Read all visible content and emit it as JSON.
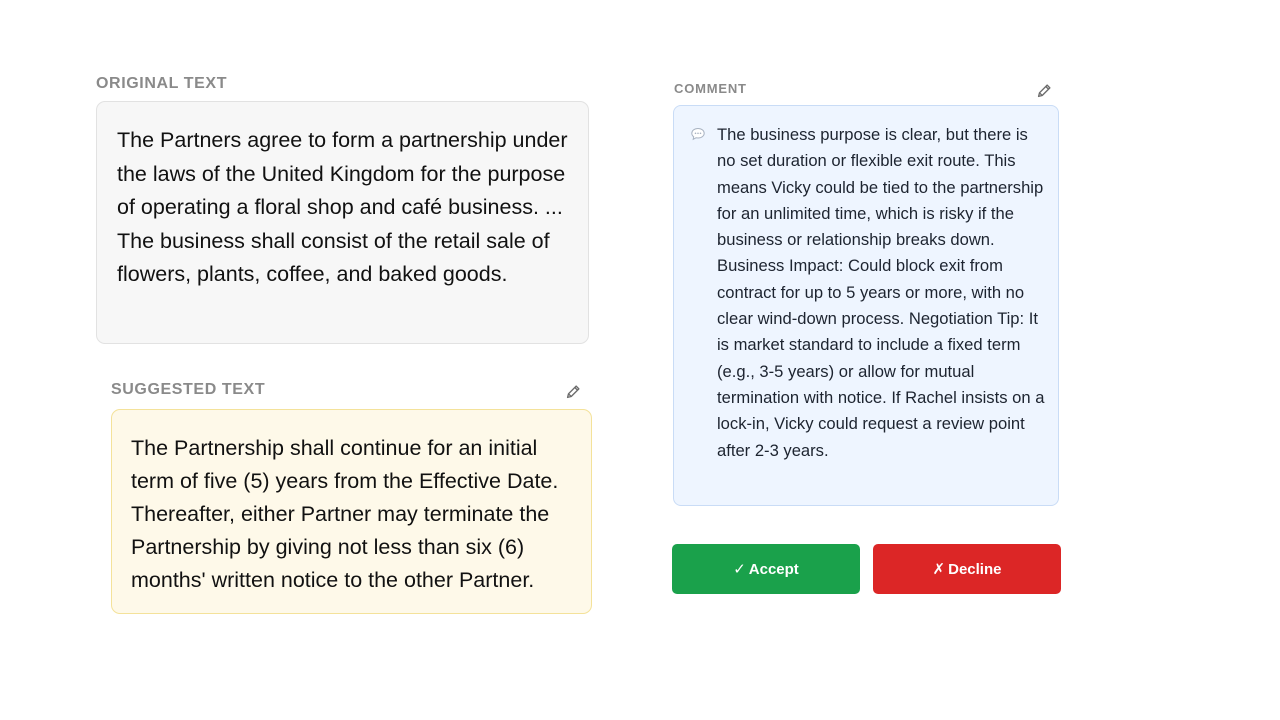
{
  "original": {
    "label": "ORIGINAL TEXT",
    "text": "The Partners agree to form a partnership under the laws of the United Kingdom for the purpose of operating a floral shop and café business. ... The business shall consist of the retail sale of flowers, plants, coffee, and baked goods."
  },
  "suggested": {
    "label": "SUGGESTED TEXT",
    "text": "The Partnership shall continue for an initial term of five (5) years from the Effective Date. Thereafter, either Partner may terminate the Partnership by giving not less than six (6) months' written notice to the other Partner.",
    "edit_icon": "pencil-icon"
  },
  "comment": {
    "label": "COMMENT",
    "icon": "speech-bubble-icon",
    "edit_icon": "pencil-icon",
    "text": "The business purpose is clear, but there is no set duration or flexible exit route. This means Vicky could be tied to the partnership for an unlimited time, which is risky if the business or relationship breaks down. Business Impact: Could block exit from contract for up to 5 years or more, with no clear wind-down process. Negotiation Tip: It is market standard to include a fixed term (e.g., 3-5 years) or allow for mutual termination with notice. If Rachel insists on a lock-in, Vicky could request a review point after 2-3 years."
  },
  "actions": {
    "accept_glyph": "✓",
    "accept_label": "Accept",
    "decline_glyph": "✗",
    "decline_label": "Decline"
  },
  "colors": {
    "accept": "#1aa14b",
    "decline": "#dc2626",
    "comment_bg": "#eef5ff",
    "suggested_bg": "#fef9e9",
    "original_bg": "#f7f7f7",
    "label": "#8a8a8a"
  }
}
